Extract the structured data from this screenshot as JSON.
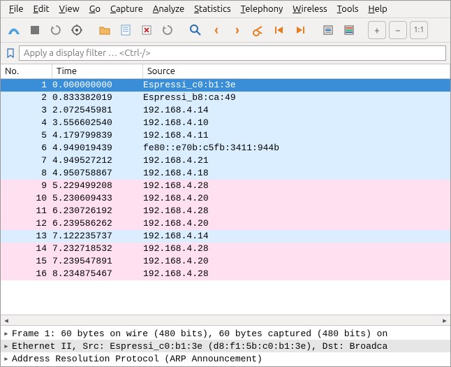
{
  "menubar": {
    "items": [
      {
        "label": "File",
        "key": "F"
      },
      {
        "label": "Edit",
        "key": "E"
      },
      {
        "label": "View",
        "key": "V"
      },
      {
        "label": "Go",
        "key": "G"
      },
      {
        "label": "Capture",
        "key": "C"
      },
      {
        "label": "Analyze",
        "key": "A"
      },
      {
        "label": "Statistics",
        "key": "S"
      },
      {
        "label": "Telephony",
        "key": "T"
      },
      {
        "label": "Wireless",
        "key": "W"
      },
      {
        "label": "Tools",
        "key": "T"
      },
      {
        "label": "Help",
        "key": "H"
      }
    ]
  },
  "filter": {
    "placeholder": "Apply a display filter … <Ctrl-/>"
  },
  "columns": {
    "no": "No.",
    "time": "Time",
    "source": "Source"
  },
  "packets": [
    {
      "no": "1",
      "time": "0.000000000",
      "source": "Espressi_c0:b1:3e",
      "class": "sel"
    },
    {
      "no": "2",
      "time": "0.833382019",
      "source": "Espressi_b8:ca:49",
      "class": "blue"
    },
    {
      "no": "3",
      "time": "2.072545981",
      "source": "192.168.4.14",
      "class": "blue"
    },
    {
      "no": "4",
      "time": "3.556602540",
      "source": "192.168.4.10",
      "class": "blue"
    },
    {
      "no": "5",
      "time": "4.179799839",
      "source": "192.168.4.11",
      "class": "blue"
    },
    {
      "no": "6",
      "time": "4.949019439",
      "source": "fe80::e70b:c5fb:3411:944b",
      "class": "blue"
    },
    {
      "no": "7",
      "time": "4.949527212",
      "source": "192.168.4.21",
      "class": "blue"
    },
    {
      "no": "8",
      "time": "4.950758867",
      "source": "192.168.4.18",
      "class": "blue"
    },
    {
      "no": "9",
      "time": "5.229499208",
      "source": "192.168.4.28",
      "class": "pink"
    },
    {
      "no": "10",
      "time": "5.230609433",
      "source": "192.168.4.20",
      "class": "pink"
    },
    {
      "no": "11",
      "time": "6.230726192",
      "source": "192.168.4.28",
      "class": "pink"
    },
    {
      "no": "12",
      "time": "6.239586262",
      "source": "192.168.4.20",
      "class": "pink"
    },
    {
      "no": "13",
      "time": "7.122235737",
      "source": "192.168.4.14",
      "class": "blue"
    },
    {
      "no": "14",
      "time": "7.232718532",
      "source": "192.168.4.28",
      "class": "pink"
    },
    {
      "no": "15",
      "time": "7.239547891",
      "source": "192.168.4.20",
      "class": "pink"
    },
    {
      "no": "16",
      "time": "8.234875467",
      "source": "192.168.4.28",
      "class": "pink"
    }
  ],
  "details": [
    {
      "text": "Frame 1: 60 bytes on wire (480 bits), 60 bytes captured (480 bits) on",
      "sel": false
    },
    {
      "text": "Ethernet II, Src: Espressi_c0:b1:3e (d8:f1:5b:c0:b1:3e), Dst: Broadca",
      "sel": true
    },
    {
      "text": "Address Resolution Protocol (ARP Announcement)",
      "sel": false
    }
  ]
}
